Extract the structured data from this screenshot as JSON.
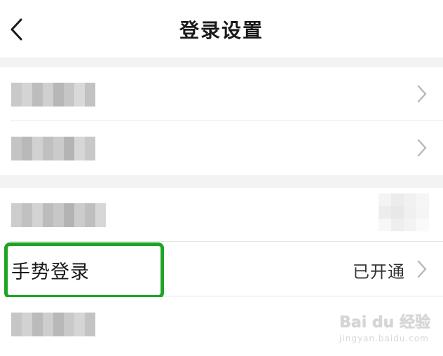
{
  "header": {
    "title": "登录设置",
    "back_icon": "chevron-left-icon"
  },
  "rows": {
    "gesture": {
      "label": "手势登录",
      "value": "已开通"
    }
  },
  "colors": {
    "highlight": "#1ea427",
    "gap_background": "#f3f3f3",
    "divider": "#e6e6e6",
    "chevron": "#b8b8b8"
  },
  "watermark": {
    "brand": "Bai du 经验",
    "url": "jingyan.baidu.com"
  }
}
